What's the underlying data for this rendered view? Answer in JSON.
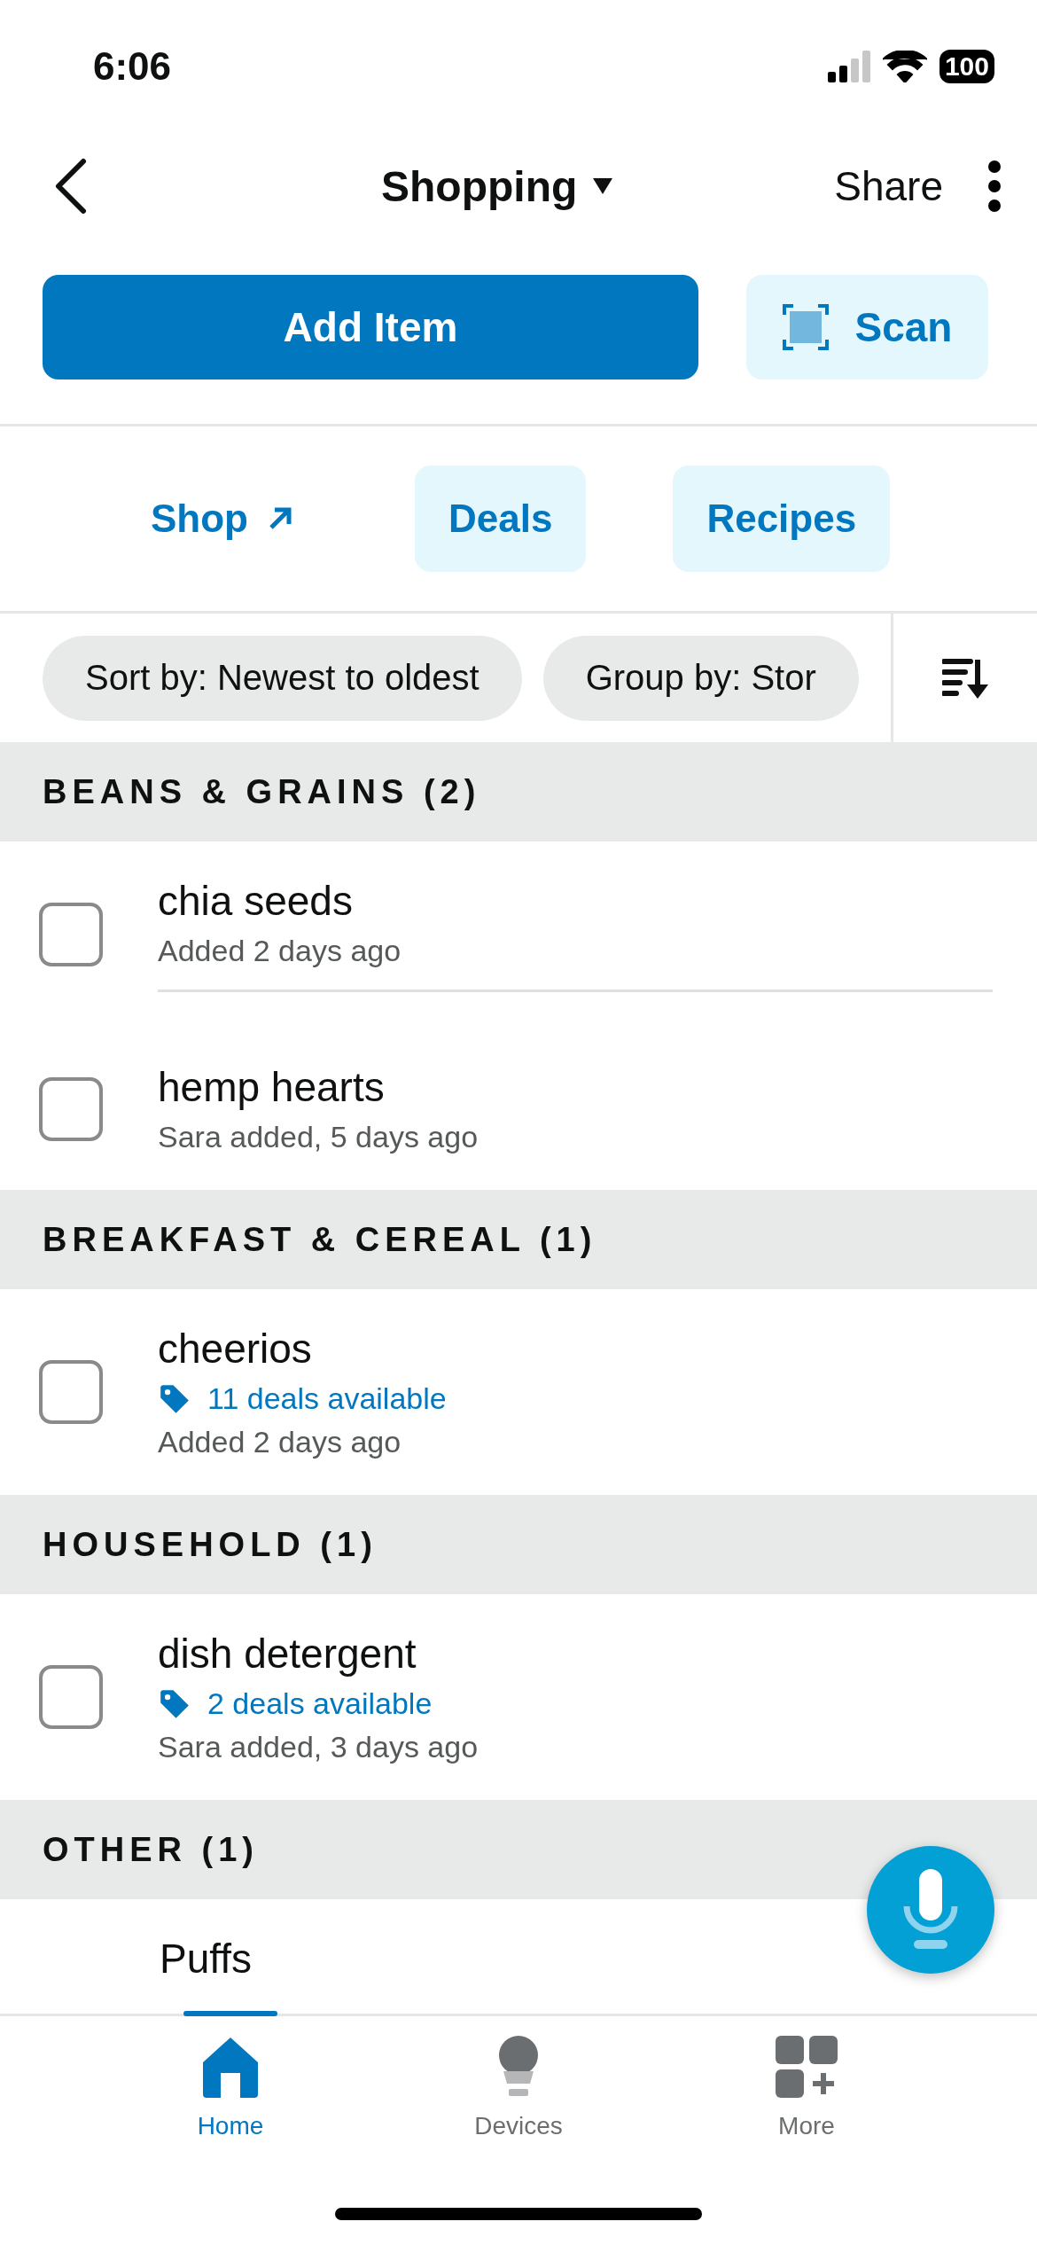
{
  "status_bar": {
    "time": "6:06",
    "battery": "100"
  },
  "header": {
    "title": "Shopping",
    "share": "Share"
  },
  "actions": {
    "add": "Add Item",
    "scan": "Scan"
  },
  "links": [
    {
      "label": "Shop",
      "kind": "external"
    },
    {
      "label": "Deals",
      "kind": "pill"
    },
    {
      "label": "Recipes",
      "kind": "pill"
    }
  ],
  "filters": [
    "Sort by: Newest to oldest",
    "Group by: Stor"
  ],
  "sections": [
    {
      "title": "BEANS & GRAINS (2)",
      "items": [
        {
          "name": "chia seeds",
          "checked": false,
          "meta": "Added 2 days ago"
        },
        {
          "name": "hemp hearts",
          "checked": false,
          "meta": "Sara added, 5 days ago"
        }
      ]
    },
    {
      "title": "BREAKFAST & CEREAL (1)",
      "items": [
        {
          "name": "cheerios",
          "checked": false,
          "deals": "11 deals available",
          "meta": "Added 2 days ago"
        }
      ]
    },
    {
      "title": "HOUSEHOLD (1)",
      "items": [
        {
          "name": "dish detergent",
          "checked": false,
          "deals": "2 deals available",
          "meta": "Sara added, 3 days ago"
        }
      ]
    },
    {
      "title": "OTHER (1)",
      "items": [
        {
          "name": "Puffs"
        }
      ]
    }
  ],
  "nav": [
    {
      "label": "Home",
      "kind": "home",
      "selected": true
    },
    {
      "label": "Devices",
      "kind": "devices",
      "selected": false
    },
    {
      "label": "More",
      "kind": "more",
      "selected": false
    }
  ]
}
